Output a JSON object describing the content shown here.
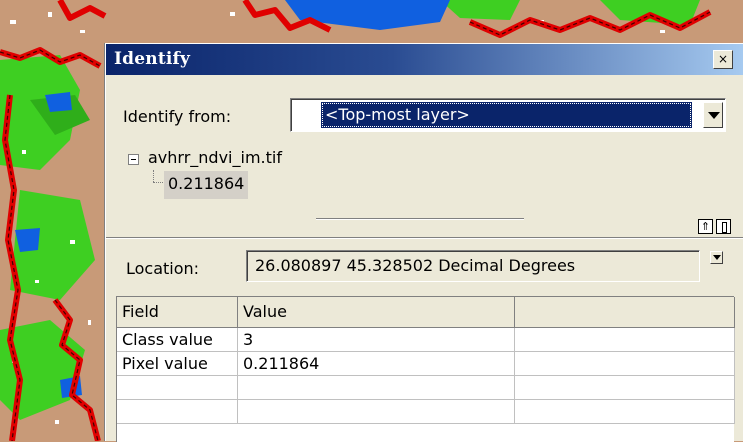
{
  "window": {
    "title": "Identify",
    "close_glyph": "×"
  },
  "identify_from": {
    "label": "Identify from:",
    "selected": "<Top-most layer>"
  },
  "tree": {
    "layer": "avhrr_ndvi_im.tif",
    "value": "0.211864"
  },
  "location": {
    "label": "Location:",
    "value": "26.080897  45.328502 Decimal Degrees"
  },
  "table": {
    "columns": [
      "Field",
      "Value",
      ""
    ],
    "rows": [
      [
        "Class value",
        "3",
        ""
      ],
      [
        "Pixel value",
        "0.211864",
        ""
      ],
      [
        "",
        "",
        ""
      ],
      [
        "",
        "",
        ""
      ]
    ]
  },
  "icons": {
    "close": "close-icon",
    "dropdown": "chevron-down-icon",
    "collapse": "collapse-icon",
    "pin": "pin-icon",
    "tree_toggle": "minus-box-icon"
  },
  "colors": {
    "titlebar": "#0a246a",
    "selection": "#0a246a",
    "dialog_bg": "#ece9d8",
    "map_boundary": "#e00000",
    "map_land": "#c89a78",
    "map_vegetation": "#3ecf22",
    "map_water": "#1060e0"
  }
}
